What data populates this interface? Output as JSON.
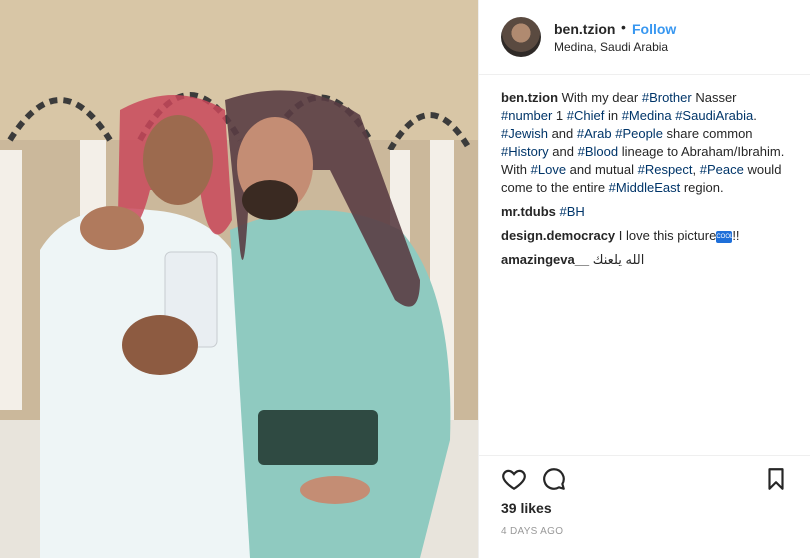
{
  "post": {
    "username": "ben.tzion",
    "separator": "•",
    "follow_label": "Follow",
    "location": "Medina, Saudi Arabia",
    "caption": [
      {
        "t": "text",
        "v": " With my dear "
      },
      {
        "t": "tag",
        "v": "#Brother"
      },
      {
        "t": "text",
        "v": " Nasser "
      },
      {
        "t": "tag",
        "v": "#number"
      },
      {
        "t": "text",
        "v": " 1 "
      },
      {
        "t": "tag",
        "v": "#Chief"
      },
      {
        "t": "text",
        "v": " in "
      },
      {
        "t": "tag",
        "v": "#Medina"
      },
      {
        "t": "text",
        "v": " "
      },
      {
        "t": "tag",
        "v": "#SaudiArabia"
      },
      {
        "t": "text",
        "v": ". "
      },
      {
        "t": "tag",
        "v": "#Jewish"
      },
      {
        "t": "text",
        "v": " and "
      },
      {
        "t": "tag",
        "v": "#Arab"
      },
      {
        "t": "text",
        "v": " "
      },
      {
        "t": "tag",
        "v": "#People"
      },
      {
        "t": "text",
        "v": " share common "
      },
      {
        "t": "tag",
        "v": "#History"
      },
      {
        "t": "text",
        "v": " and "
      },
      {
        "t": "tag",
        "v": "#Blood"
      },
      {
        "t": "text",
        "v": " lineage to Abraham/Ibrahim. With "
      },
      {
        "t": "tag",
        "v": "#Love"
      },
      {
        "t": "text",
        "v": " and mutual "
      },
      {
        "t": "tag",
        "v": "#Respect"
      },
      {
        "t": "text",
        "v": ", "
      },
      {
        "t": "tag",
        "v": "#Peace"
      },
      {
        "t": "text",
        "v": " would come to the entire "
      },
      {
        "t": "tag",
        "v": "#MiddleEast"
      },
      {
        "t": "text",
        "v": " region."
      }
    ],
    "comments": [
      {
        "user": "mr.tdubs",
        "text": "",
        "tag": "#BH",
        "emoji": ""
      },
      {
        "user": "design.democracy",
        "text": " I love this picture",
        "tag": "",
        "emoji": "COOL",
        "suffix": "!!"
      },
      {
        "user": "amazingeva__",
        "text": " الله يلعنك",
        "tag": "",
        "emoji": ""
      }
    ],
    "likes": "39 likes",
    "time": "4 DAYS AGO",
    "icons": {
      "like": "heart-icon",
      "comment": "comment-icon",
      "save": "bookmark-icon"
    },
    "colors": {
      "link": "#3897f0",
      "hashtag": "#003569",
      "muted": "#999999",
      "border": "#efefef"
    }
  }
}
